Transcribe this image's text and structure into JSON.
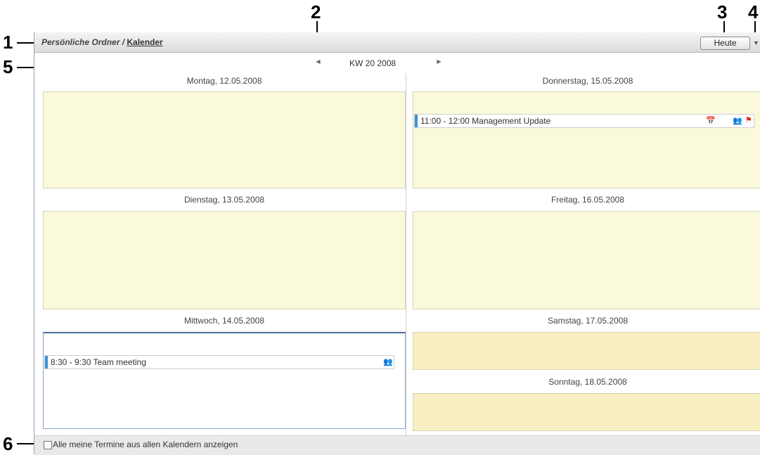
{
  "callouts": [
    "1",
    "2",
    "3",
    "4",
    "5",
    "6"
  ],
  "header": {
    "breadcrumb_folder": "Persönliche Ordner / ",
    "breadcrumb_calendar": "Kalender",
    "today_button": "Heute"
  },
  "week": {
    "label": "KW 20 2008"
  },
  "days": {
    "mon": {
      "title": "Montag, 12.05.2008"
    },
    "tue": {
      "title": "Dienstag, 13.05.2008"
    },
    "wed": {
      "title": "Mittwoch, 14.05.2008",
      "event": "8:30 - 9:30 Team meeting"
    },
    "thu": {
      "title": "Donnerstag, 15.05.2008",
      "event": "11:00 - 12:00 Management Update"
    },
    "fri": {
      "title": "Freitag, 16.05.2008"
    },
    "sat": {
      "title": "Samstag, 17.05.2008"
    },
    "sun": {
      "title": "Sonntag, 18.05.2008"
    }
  },
  "footer": {
    "show_all_label": "Alle meine Termine aus allen Kalendern anzeigen"
  },
  "colors": {
    "event_bar": "#3b93d6",
    "weekday_bg": "#fbf9dc",
    "weekend_bg": "#f8efc3"
  }
}
